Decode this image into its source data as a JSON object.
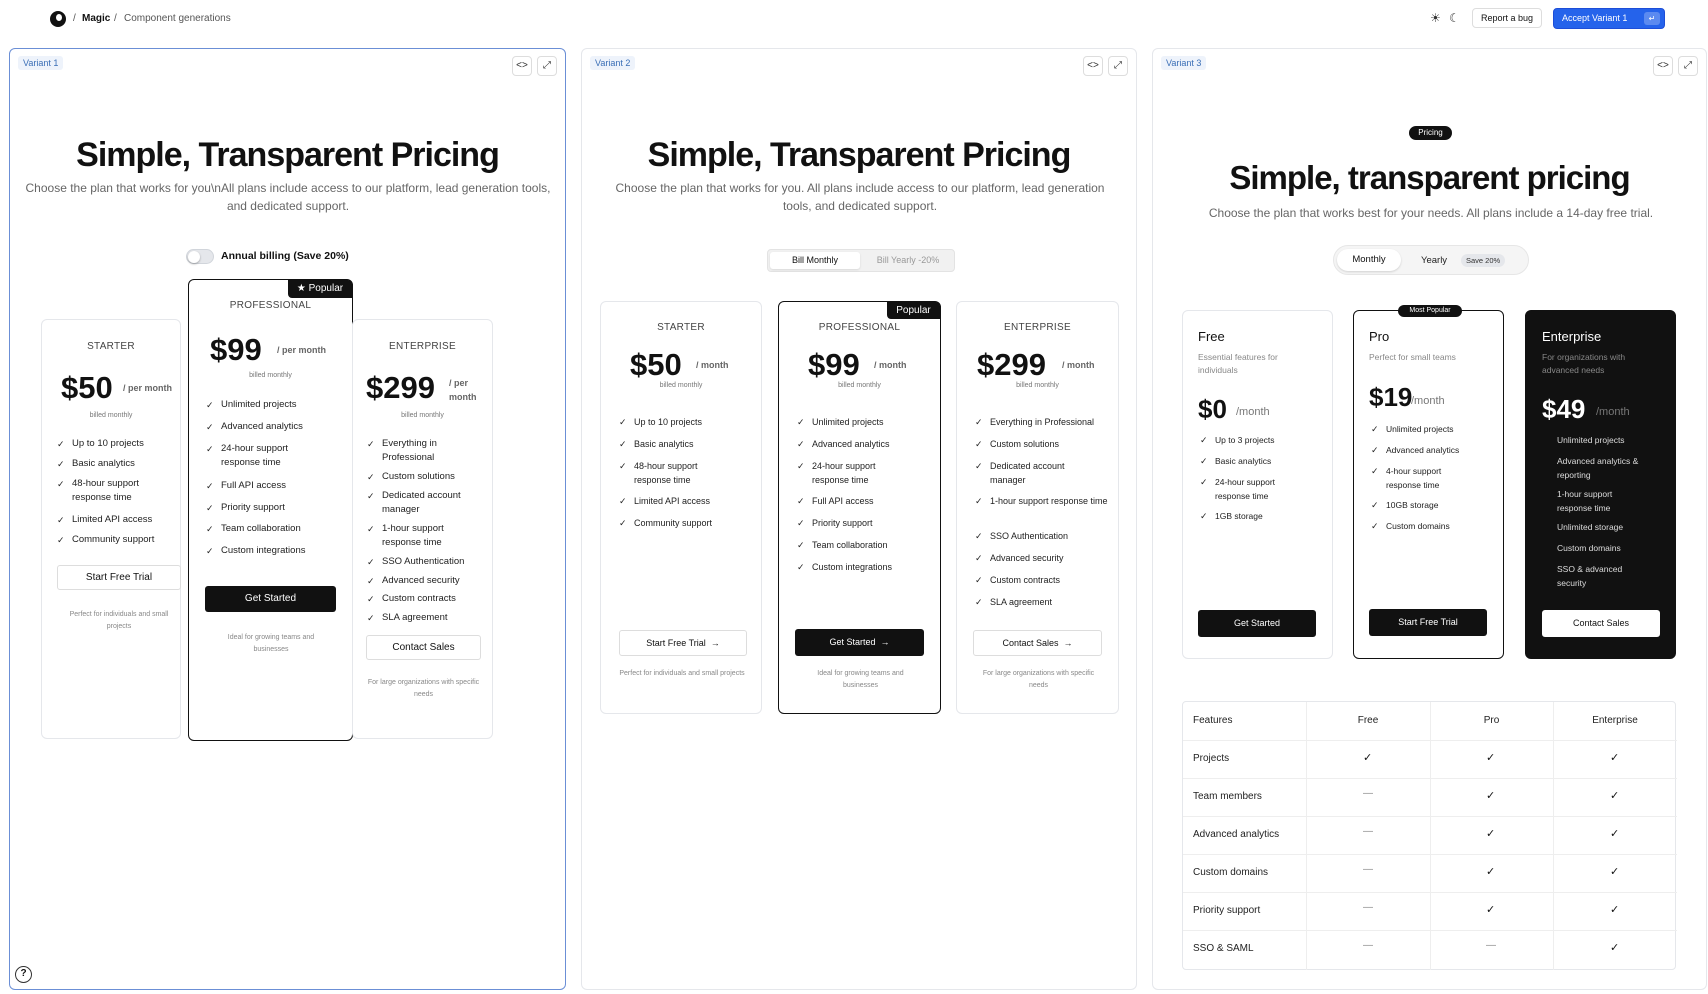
{
  "topbar": {
    "sep1": "/",
    "app": "Magic",
    "sep2": "/",
    "page": "Component generations",
    "report_bug": "Report a bug",
    "accept": "Accept Variant 1",
    "accept_kbd": "↵"
  },
  "variant1": {
    "tag": "Variant 1",
    "title": "Simple, Transparent Pricing",
    "subtitle": "Choose the plan that works for you\\nAll plans include access to our platform, lead generation tools, and dedicated support.",
    "toggle_label": "Annual billing (Save 20%)",
    "popular": "Popular",
    "plans": [
      {
        "name": "STARTER",
        "price": "$50",
        "per": "/ per month",
        "billed": "billed monthly",
        "features": [
          "Up to 10 projects",
          "Basic analytics",
          "48-hour support response time",
          "Limited API access",
          "Community support"
        ],
        "cta": "Start Free Trial",
        "note": "Perfect for individuals and small projects"
      },
      {
        "name": "PROFESSIONAL",
        "price": "$99",
        "per": "/ per month",
        "billed": "billed monthly",
        "features": [
          "Unlimited projects",
          "Advanced analytics",
          "24-hour support response time",
          "Full API access",
          "Priority support",
          "Team collaboration",
          "Custom integrations"
        ],
        "cta": "Get Started",
        "note": "Ideal for growing teams and businesses"
      },
      {
        "name": "ENTERPRISE",
        "price": "$299",
        "per": "/ per month",
        "billed": "billed monthly",
        "features": [
          "Everything in Professional",
          "Custom solutions",
          "Dedicated account manager",
          "1-hour support response time",
          "SSO Authentication",
          "Advanced security",
          "Custom contracts",
          "SLA agreement"
        ],
        "cta": "Contact Sales",
        "note": "For large organizations with specific needs"
      }
    ]
  },
  "variant2": {
    "tag": "Variant 2",
    "title": "Simple, Transparent Pricing",
    "subtitle": "Choose the plan that works for you. All plans include access to our platform, lead generation tools, and dedicated support.",
    "bill_monthly": "Bill Monthly",
    "bill_yearly": "Bill Yearly -20%",
    "popular": "Popular",
    "plans": [
      {
        "name": "STARTER",
        "price": "$50",
        "per": "/ month",
        "billed": "billed monthly",
        "features": [
          "Up to 10 projects",
          "Basic analytics",
          "48-hour support response time",
          "Limited API access",
          "Community support"
        ],
        "cta": "Start Free Trial",
        "note": "Perfect for individuals and small projects"
      },
      {
        "name": "PROFESSIONAL",
        "price": "$99",
        "per": "/ month",
        "billed": "billed monthly",
        "features": [
          "Unlimited projects",
          "Advanced analytics",
          "24-hour support response time",
          "Full API access",
          "Priority support",
          "Team collaboration",
          "Custom integrations"
        ],
        "cta": "Get Started",
        "note": "Ideal for growing teams and businesses"
      },
      {
        "name": "ENTERPRISE",
        "price": "$299",
        "per": "/ month",
        "billed": "billed monthly",
        "features": [
          "Everything in Professional",
          "Custom solutions",
          "Dedicated account manager",
          "1-hour support response time",
          "SSO Authentication",
          "Advanced security",
          "Custom contracts",
          "SLA agreement"
        ],
        "cta": "Contact Sales",
        "note": "For large organizations with specific needs"
      }
    ]
  },
  "variant3": {
    "tag": "Variant 3",
    "pill": "Pricing",
    "title": "Simple, transparent pricing",
    "subtitle": "Choose the plan that works best for your needs. All plans include a 14-day free trial.",
    "monthly": "Monthly",
    "yearly": "Yearly",
    "save": "Save 20%",
    "most_popular": "Most Popular",
    "plans": [
      {
        "name": "Free",
        "desc": "Essential features for individuals",
        "price": "$0",
        "per": "/month",
        "features": [
          "Up to 3 projects",
          "Basic analytics",
          "24-hour support response time",
          "1GB storage"
        ],
        "cta": "Get Started"
      },
      {
        "name": "Pro",
        "desc": "Perfect for small teams",
        "price": "$19",
        "per": "/month",
        "features": [
          "Unlimited projects",
          "Advanced analytics",
          "4-hour support response time",
          "10GB storage",
          "Custom domains"
        ],
        "cta": "Start Free Trial"
      },
      {
        "name": "Enterprise",
        "desc": "For organizations with advanced needs",
        "price": "$49",
        "per": "/month",
        "features": [
          "Unlimited projects",
          "Advanced analytics & reporting",
          "1-hour support response time",
          "Unlimited storage",
          "Custom domains",
          "SSO & advanced security"
        ],
        "cta": "Contact Sales"
      }
    ],
    "table": {
      "headers": [
        "Features",
        "Free",
        "Pro",
        "Enterprise"
      ],
      "rows": [
        {
          "feature": "Projects",
          "free": true,
          "pro": true,
          "ent": true
        },
        {
          "feature": "Team members",
          "free": false,
          "pro": true,
          "ent": true
        },
        {
          "feature": "Advanced analytics",
          "free": false,
          "pro": true,
          "ent": true
        },
        {
          "feature": "Custom domains",
          "free": false,
          "pro": true,
          "ent": true
        },
        {
          "feature": "Priority support",
          "free": false,
          "pro": true,
          "ent": true
        },
        {
          "feature": "SSO & SAML",
          "free": false,
          "pro": false,
          "ent": true
        }
      ]
    }
  },
  "help": "?"
}
